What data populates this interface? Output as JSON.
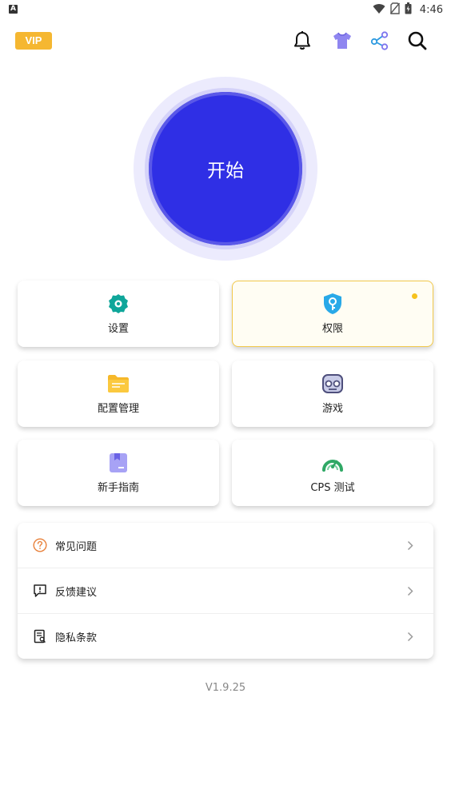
{
  "status_bar": {
    "time": "4:46",
    "icons": [
      "app-notification-icon",
      "wifi-icon",
      "no-sim-icon",
      "battery-icon"
    ]
  },
  "header": {
    "vip_label": "VIP",
    "icons": [
      "bell-icon",
      "shirt-icon",
      "share-icon",
      "search-icon"
    ]
  },
  "start_button": {
    "label": "开始",
    "color": "#2F2FE5"
  },
  "grid": [
    {
      "label": "设置",
      "icon": "gear-icon",
      "color": "#0FA69A"
    },
    {
      "label": "权限",
      "icon": "shield-key-icon",
      "color": "#29A9E8",
      "badge": true
    },
    {
      "label": "配置管理",
      "icon": "folder-icon",
      "color": "#F6B82A"
    },
    {
      "label": "游戏",
      "icon": "gamepad-icon",
      "color": "#5B5C8C"
    },
    {
      "label": "新手指南",
      "icon": "guide-book-icon",
      "color": "#8C86F2"
    },
    {
      "label": "CPS 测试",
      "icon": "speedometer-icon",
      "color": "#2FA865"
    }
  ],
  "menu": [
    {
      "label": "常见问题",
      "icon": "question-circle-icon"
    },
    {
      "label": "反馈建议",
      "icon": "feedback-icon"
    },
    {
      "label": "隐私条款",
      "icon": "privacy-document-icon"
    }
  ],
  "version": "V1.9.25"
}
